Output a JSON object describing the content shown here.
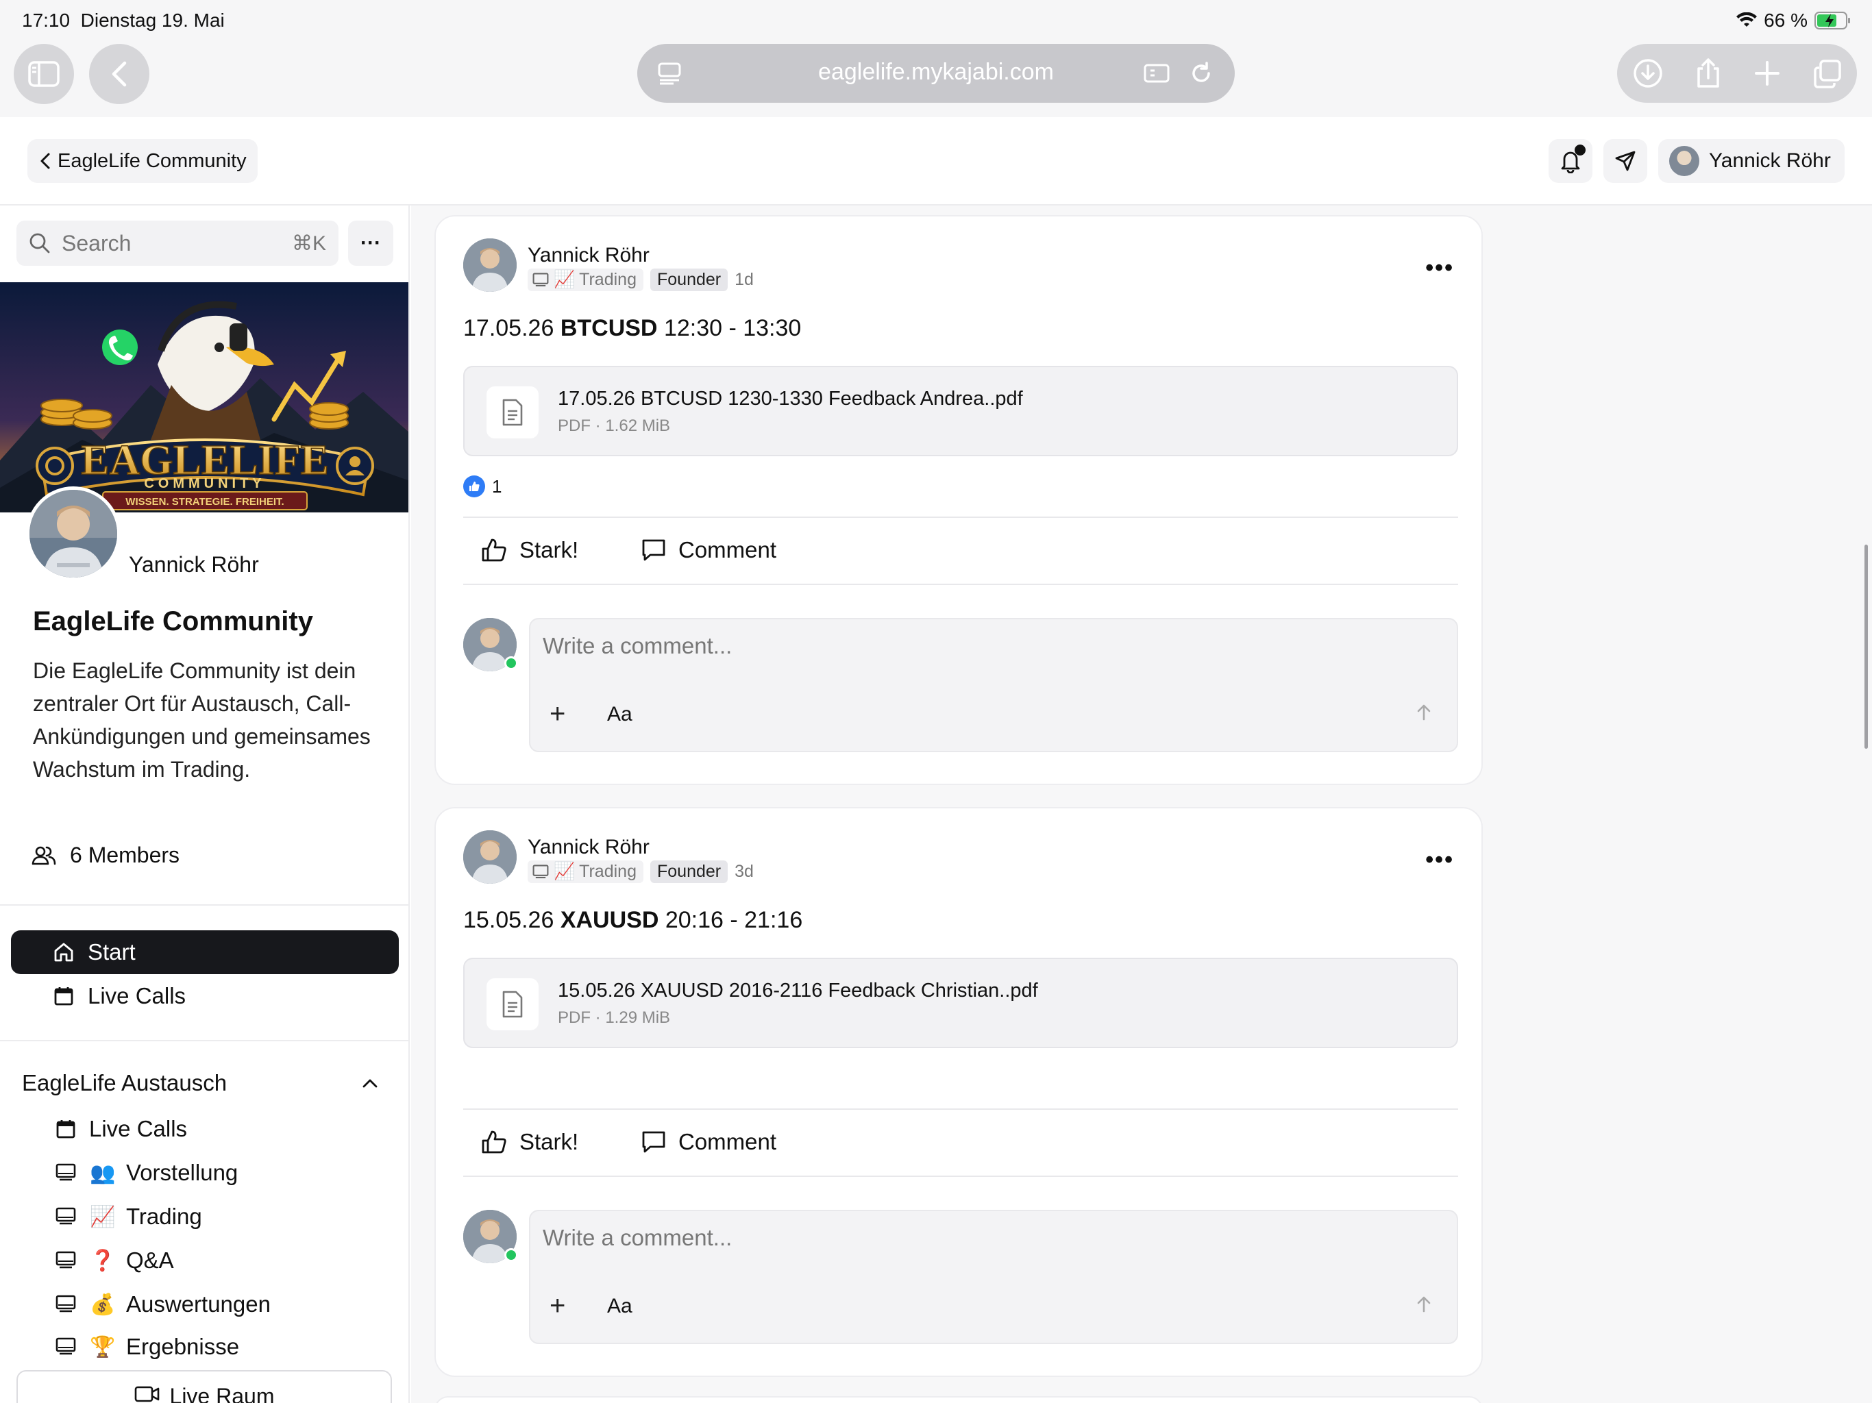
{
  "status_bar": {
    "time": "17:10",
    "date": "Dienstag 19. Mai",
    "battery": "66 %"
  },
  "browser": {
    "url": "eaglelife.mykajabi.com"
  },
  "header": {
    "back_label": "EagleLife Community",
    "user_name": "Yannick Röhr"
  },
  "sidebar": {
    "search_placeholder": "Search",
    "search_shortcut": "⌘K",
    "more_label": "···",
    "banner": {
      "title": "EAGLELIFE",
      "subtitle": "COMMUNITY",
      "tagline": "WISSEN. STRATEGIE. FREIHEIT."
    },
    "owner_name": "Yannick Röhr",
    "community_title": "EagleLife Community",
    "description": "Die EagleLife Community ist dein zentraler Ort für Austausch, Call-Ankündigungen und gemeinsames Wachstum im Trading.",
    "members": "6 Members",
    "nav": [
      {
        "label": "Start",
        "icon": "home-icon",
        "active": true
      },
      {
        "label": "Live Calls",
        "icon": "calendar-icon",
        "active": false
      }
    ],
    "section_title": "EagleLife Austausch",
    "channels": [
      {
        "label": "Live Calls",
        "icon": "calendar-icon",
        "emoji": ""
      },
      {
        "label": "Vorstellung",
        "icon": "monitor-icon",
        "emoji": "👥"
      },
      {
        "label": "Trading",
        "icon": "monitor-icon",
        "emoji": "📈"
      },
      {
        "label": "Q&A",
        "icon": "monitor-icon",
        "emoji": "❓"
      },
      {
        "label": "Auswertungen",
        "icon": "monitor-icon",
        "emoji": "💰"
      },
      {
        "label": "Ergebnisse",
        "icon": "monitor-icon",
        "emoji": "🏆"
      }
    ],
    "live_room_label": "Live Raum"
  },
  "posts": [
    {
      "author": "Yannick Röhr",
      "channel": "Trading",
      "channel_emoji": "📈",
      "badge": "Founder",
      "age": "1d",
      "title_date": "17.05.26",
      "title_symbol": "BTCUSD",
      "title_time": "12:30 - 13:30",
      "attachment_name": "17.05.26 BTCUSD 1230-1330 Feedback Andrea..pdf",
      "attachment_meta": "PDF · 1.62 MiB",
      "like_count": "1",
      "like_label": "Stark!",
      "comment_label": "Comment",
      "comment_placeholder": "Write a comment...",
      "format_label": "Aa"
    },
    {
      "author": "Yannick Röhr",
      "channel": "Trading",
      "channel_emoji": "📈",
      "badge": "Founder",
      "age": "3d",
      "title_date": "15.05.26",
      "title_symbol": "XAUUSD",
      "title_time": "20:16 - 21:16",
      "attachment_name": "15.05.26 XAUUSD 2016-2116 Feedback Christian..pdf",
      "attachment_meta": "PDF · 1.29 MiB",
      "like_label": "Stark!",
      "comment_label": "Comment",
      "comment_placeholder": "Write a comment...",
      "format_label": "Aa"
    }
  ],
  "colors": {
    "accent_dark": "#17181c",
    "like_blue": "#2e7cf6",
    "online_green": "#22c55e"
  }
}
